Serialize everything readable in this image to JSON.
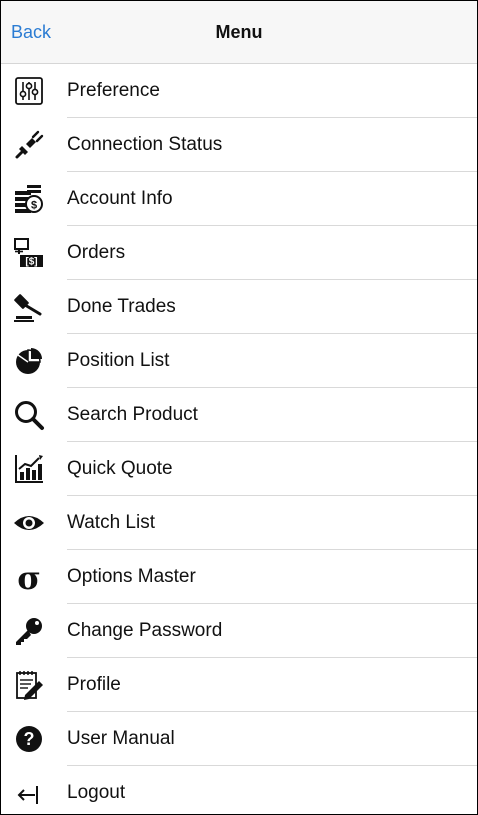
{
  "navbar": {
    "back_label": "Back",
    "title": "Menu"
  },
  "menu": {
    "items": [
      {
        "label": "Preference",
        "icon": "sliders-icon"
      },
      {
        "label": "Connection Status",
        "icon": "plug-icon"
      },
      {
        "label": "Account Info",
        "icon": "account-cash-icon"
      },
      {
        "label": "Orders",
        "icon": "orders-icon"
      },
      {
        "label": "Done Trades",
        "icon": "gavel-icon"
      },
      {
        "label": "Position List",
        "icon": "pie-chart-icon"
      },
      {
        "label": "Search Product",
        "icon": "search-icon"
      },
      {
        "label": "Quick Quote",
        "icon": "bar-chart-icon"
      },
      {
        "label": "Watch List",
        "icon": "eye-icon"
      },
      {
        "label": "Options Master",
        "icon": "sigma-icon"
      },
      {
        "label": "Change Password",
        "icon": "key-icon"
      },
      {
        "label": "Profile",
        "icon": "profile-edit-icon"
      },
      {
        "label": "User Manual",
        "icon": "question-circle-icon"
      },
      {
        "label": "Logout",
        "icon": "logout-arrow-icon"
      }
    ]
  },
  "colors": {
    "accent": "#2b7cd3",
    "text": "#111111",
    "navbar_bg": "#f7f7f7",
    "separator": "#d9d9d9"
  }
}
